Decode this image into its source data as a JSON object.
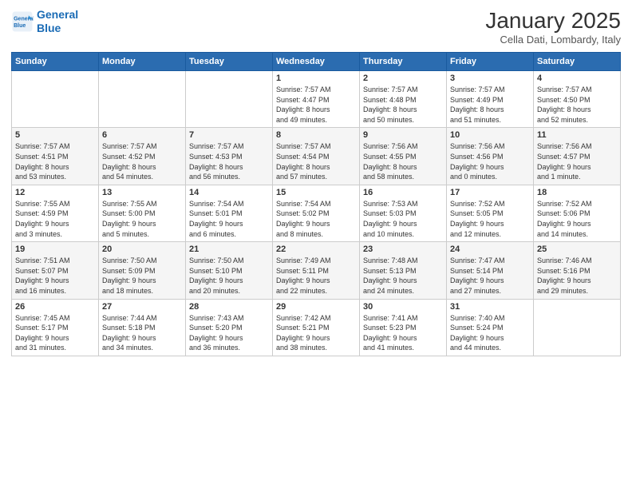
{
  "logo": {
    "line1": "General",
    "line2": "Blue"
  },
  "title": "January 2025",
  "location": "Cella Dati, Lombardy, Italy",
  "weekdays": [
    "Sunday",
    "Monday",
    "Tuesday",
    "Wednesday",
    "Thursday",
    "Friday",
    "Saturday"
  ],
  "weeks": [
    [
      {
        "day": "",
        "info": ""
      },
      {
        "day": "",
        "info": ""
      },
      {
        "day": "",
        "info": ""
      },
      {
        "day": "1",
        "info": "Sunrise: 7:57 AM\nSunset: 4:47 PM\nDaylight: 8 hours\nand 49 minutes."
      },
      {
        "day": "2",
        "info": "Sunrise: 7:57 AM\nSunset: 4:48 PM\nDaylight: 8 hours\nand 50 minutes."
      },
      {
        "day": "3",
        "info": "Sunrise: 7:57 AM\nSunset: 4:49 PM\nDaylight: 8 hours\nand 51 minutes."
      },
      {
        "day": "4",
        "info": "Sunrise: 7:57 AM\nSunset: 4:50 PM\nDaylight: 8 hours\nand 52 minutes."
      }
    ],
    [
      {
        "day": "5",
        "info": "Sunrise: 7:57 AM\nSunset: 4:51 PM\nDaylight: 8 hours\nand 53 minutes."
      },
      {
        "day": "6",
        "info": "Sunrise: 7:57 AM\nSunset: 4:52 PM\nDaylight: 8 hours\nand 54 minutes."
      },
      {
        "day": "7",
        "info": "Sunrise: 7:57 AM\nSunset: 4:53 PM\nDaylight: 8 hours\nand 56 minutes."
      },
      {
        "day": "8",
        "info": "Sunrise: 7:57 AM\nSunset: 4:54 PM\nDaylight: 8 hours\nand 57 minutes."
      },
      {
        "day": "9",
        "info": "Sunrise: 7:56 AM\nSunset: 4:55 PM\nDaylight: 8 hours\nand 58 minutes."
      },
      {
        "day": "10",
        "info": "Sunrise: 7:56 AM\nSunset: 4:56 PM\nDaylight: 9 hours\nand 0 minutes."
      },
      {
        "day": "11",
        "info": "Sunrise: 7:56 AM\nSunset: 4:57 PM\nDaylight: 9 hours\nand 1 minute."
      }
    ],
    [
      {
        "day": "12",
        "info": "Sunrise: 7:55 AM\nSunset: 4:59 PM\nDaylight: 9 hours\nand 3 minutes."
      },
      {
        "day": "13",
        "info": "Sunrise: 7:55 AM\nSunset: 5:00 PM\nDaylight: 9 hours\nand 5 minutes."
      },
      {
        "day": "14",
        "info": "Sunrise: 7:54 AM\nSunset: 5:01 PM\nDaylight: 9 hours\nand 6 minutes."
      },
      {
        "day": "15",
        "info": "Sunrise: 7:54 AM\nSunset: 5:02 PM\nDaylight: 9 hours\nand 8 minutes."
      },
      {
        "day": "16",
        "info": "Sunrise: 7:53 AM\nSunset: 5:03 PM\nDaylight: 9 hours\nand 10 minutes."
      },
      {
        "day": "17",
        "info": "Sunrise: 7:52 AM\nSunset: 5:05 PM\nDaylight: 9 hours\nand 12 minutes."
      },
      {
        "day": "18",
        "info": "Sunrise: 7:52 AM\nSunset: 5:06 PM\nDaylight: 9 hours\nand 14 minutes."
      }
    ],
    [
      {
        "day": "19",
        "info": "Sunrise: 7:51 AM\nSunset: 5:07 PM\nDaylight: 9 hours\nand 16 minutes."
      },
      {
        "day": "20",
        "info": "Sunrise: 7:50 AM\nSunset: 5:09 PM\nDaylight: 9 hours\nand 18 minutes."
      },
      {
        "day": "21",
        "info": "Sunrise: 7:50 AM\nSunset: 5:10 PM\nDaylight: 9 hours\nand 20 minutes."
      },
      {
        "day": "22",
        "info": "Sunrise: 7:49 AM\nSunset: 5:11 PM\nDaylight: 9 hours\nand 22 minutes."
      },
      {
        "day": "23",
        "info": "Sunrise: 7:48 AM\nSunset: 5:13 PM\nDaylight: 9 hours\nand 24 minutes."
      },
      {
        "day": "24",
        "info": "Sunrise: 7:47 AM\nSunset: 5:14 PM\nDaylight: 9 hours\nand 27 minutes."
      },
      {
        "day": "25",
        "info": "Sunrise: 7:46 AM\nSunset: 5:16 PM\nDaylight: 9 hours\nand 29 minutes."
      }
    ],
    [
      {
        "day": "26",
        "info": "Sunrise: 7:45 AM\nSunset: 5:17 PM\nDaylight: 9 hours\nand 31 minutes."
      },
      {
        "day": "27",
        "info": "Sunrise: 7:44 AM\nSunset: 5:18 PM\nDaylight: 9 hours\nand 34 minutes."
      },
      {
        "day": "28",
        "info": "Sunrise: 7:43 AM\nSunset: 5:20 PM\nDaylight: 9 hours\nand 36 minutes."
      },
      {
        "day": "29",
        "info": "Sunrise: 7:42 AM\nSunset: 5:21 PM\nDaylight: 9 hours\nand 38 minutes."
      },
      {
        "day": "30",
        "info": "Sunrise: 7:41 AM\nSunset: 5:23 PM\nDaylight: 9 hours\nand 41 minutes."
      },
      {
        "day": "31",
        "info": "Sunrise: 7:40 AM\nSunset: 5:24 PM\nDaylight: 9 hours\nand 44 minutes."
      },
      {
        "day": "",
        "info": ""
      }
    ]
  ]
}
